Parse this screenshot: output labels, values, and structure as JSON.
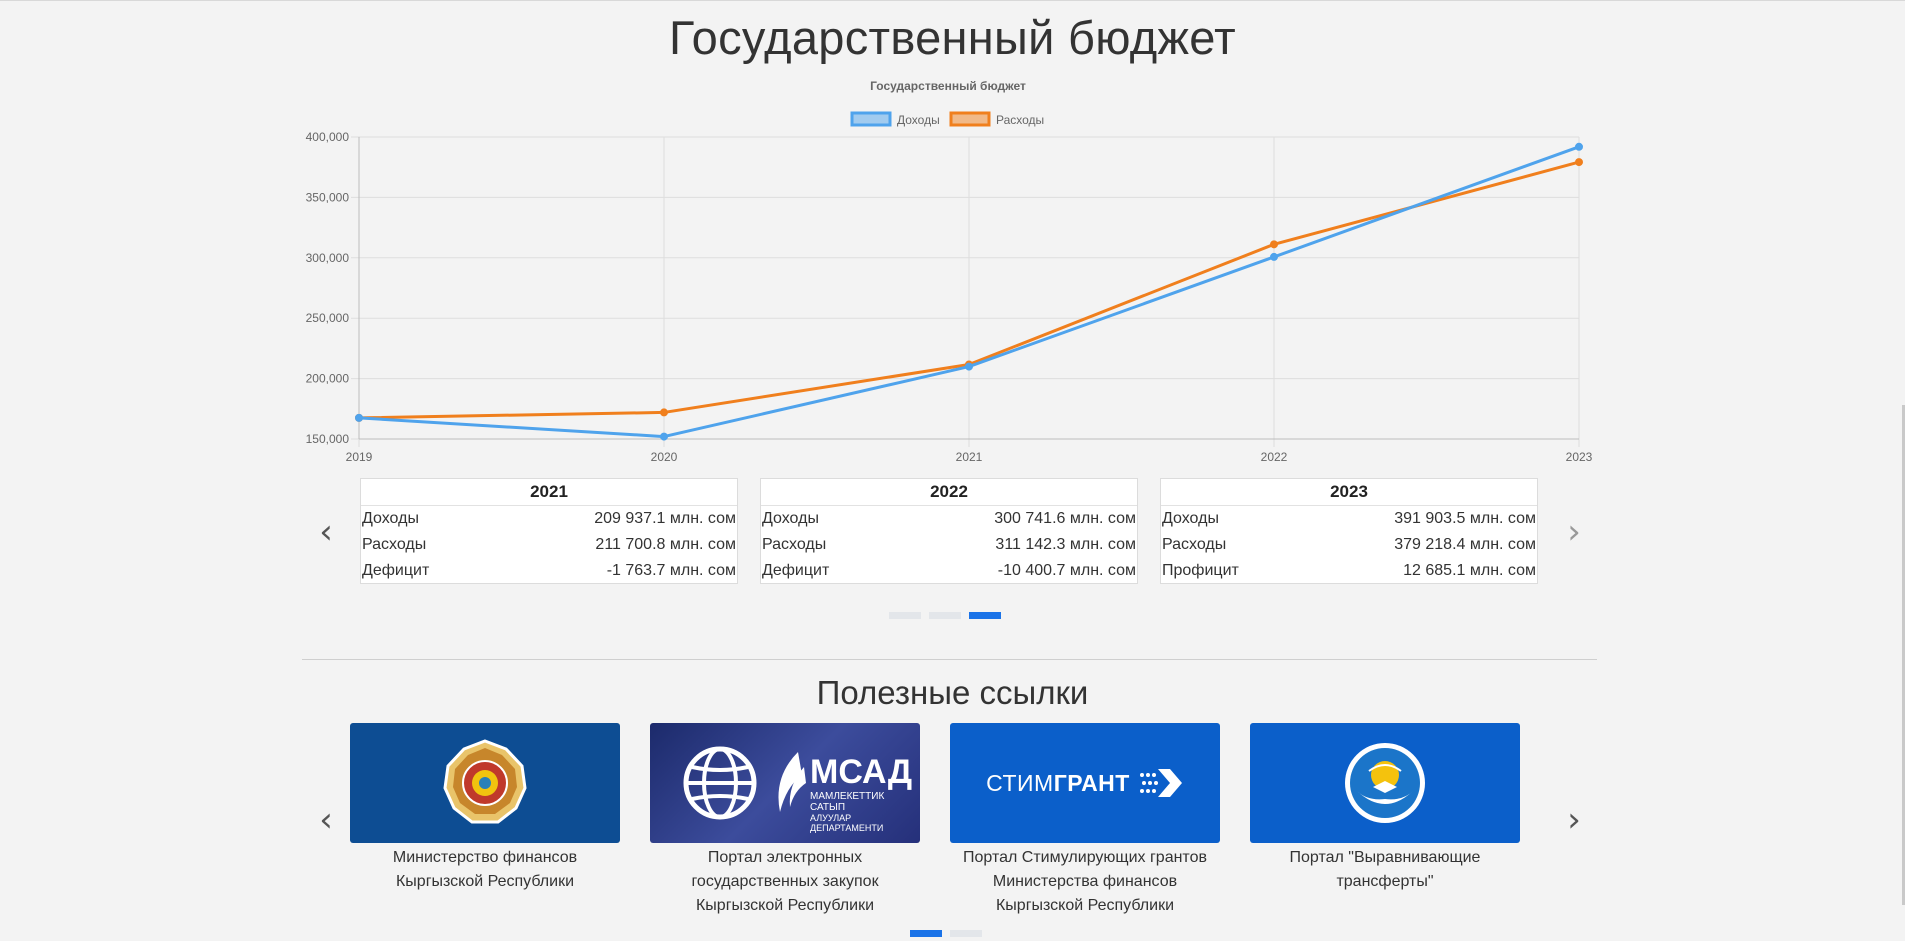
{
  "page": {
    "title": "Государственный бюджет"
  },
  "chart_data": {
    "type": "line",
    "title": "Государственный бюджет",
    "legend_position": "top",
    "grid": true,
    "x": [
      "2019",
      "2020",
      "2021",
      "2022",
      "2023"
    ],
    "ylim": [
      150000,
      400000
    ],
    "y_ticks": [
      "150,000",
      "200,000",
      "250,000",
      "300,000",
      "350,000",
      "400,000"
    ],
    "series": [
      {
        "name": "Доходы",
        "color": "#4fa3ec",
        "values": [
          167500,
          152000,
          209937.1,
          300741.6,
          391903.5
        ]
      },
      {
        "name": "Расходы",
        "color": "#f07f1d",
        "values": [
          167500,
          172000,
          211700.8,
          311142.3,
          379218.4
        ]
      }
    ]
  },
  "budget_cards": [
    {
      "year": "2021",
      "rows": [
        {
          "label": "Доходы",
          "value": "209 937.1 млн. сом"
        },
        {
          "label": "Расходы",
          "value": "211 700.8 млн. сом"
        },
        {
          "label": "Дефицит",
          "value": "-1 763.7 млн. сом"
        }
      ]
    },
    {
      "year": "2022",
      "rows": [
        {
          "label": "Доходы",
          "value": "300 741.6 млн. сом"
        },
        {
          "label": "Расходы",
          "value": "311 142.3 млн. сом"
        },
        {
          "label": "Дефицит",
          "value": "-10 400.7 млн. сом"
        }
      ]
    },
    {
      "year": "2023",
      "rows": [
        {
          "label": "Доходы",
          "value": "391 903.5 млн. сом"
        },
        {
          "label": "Расходы",
          "value": "379 218.4 млн. сом"
        },
        {
          "label": "Профицит",
          "value": "12 685.1 млн. сом"
        }
      ]
    }
  ],
  "budget_carousel": {
    "prev_icon": "‹",
    "next_icon": "›",
    "slide_count": 3,
    "active_slide": 3
  },
  "links_section": {
    "title": "Полезные ссылки",
    "prev_icon": "‹",
    "next_icon": "›",
    "slide_count": 2,
    "active_slide": 1,
    "items": [
      {
        "caption": "Министерство финансов Кыргызской Республики",
        "tile_color": "#0d4d93",
        "icon": "ministry-emblem-icon"
      },
      {
        "caption": "Портал электронных государственных закупок Кыргызской Республики",
        "tile_color": "#2b3a8a",
        "icon": "msad-logo-icon",
        "logo_text": "МСАД",
        "logo_sub1": "МАМЛЕКЕТТИК САТЫП",
        "logo_sub2": "АЛУУЛАР ДЕПАРТАМЕНТИ"
      },
      {
        "caption": "Портал Стимулирующих грантов Министерства финансов Кыргызской Республики",
        "tile_color": "#0b5fca",
        "icon": "stimgrant-logo-icon",
        "logo_light": "СТИМ",
        "logo_bold": "ГРАНТ"
      },
      {
        "caption": "Портал \"Выравнивающие трансферты\"",
        "tile_color": "#0b5fca",
        "icon": "kyrgyz-emblem-icon"
      }
    ]
  }
}
